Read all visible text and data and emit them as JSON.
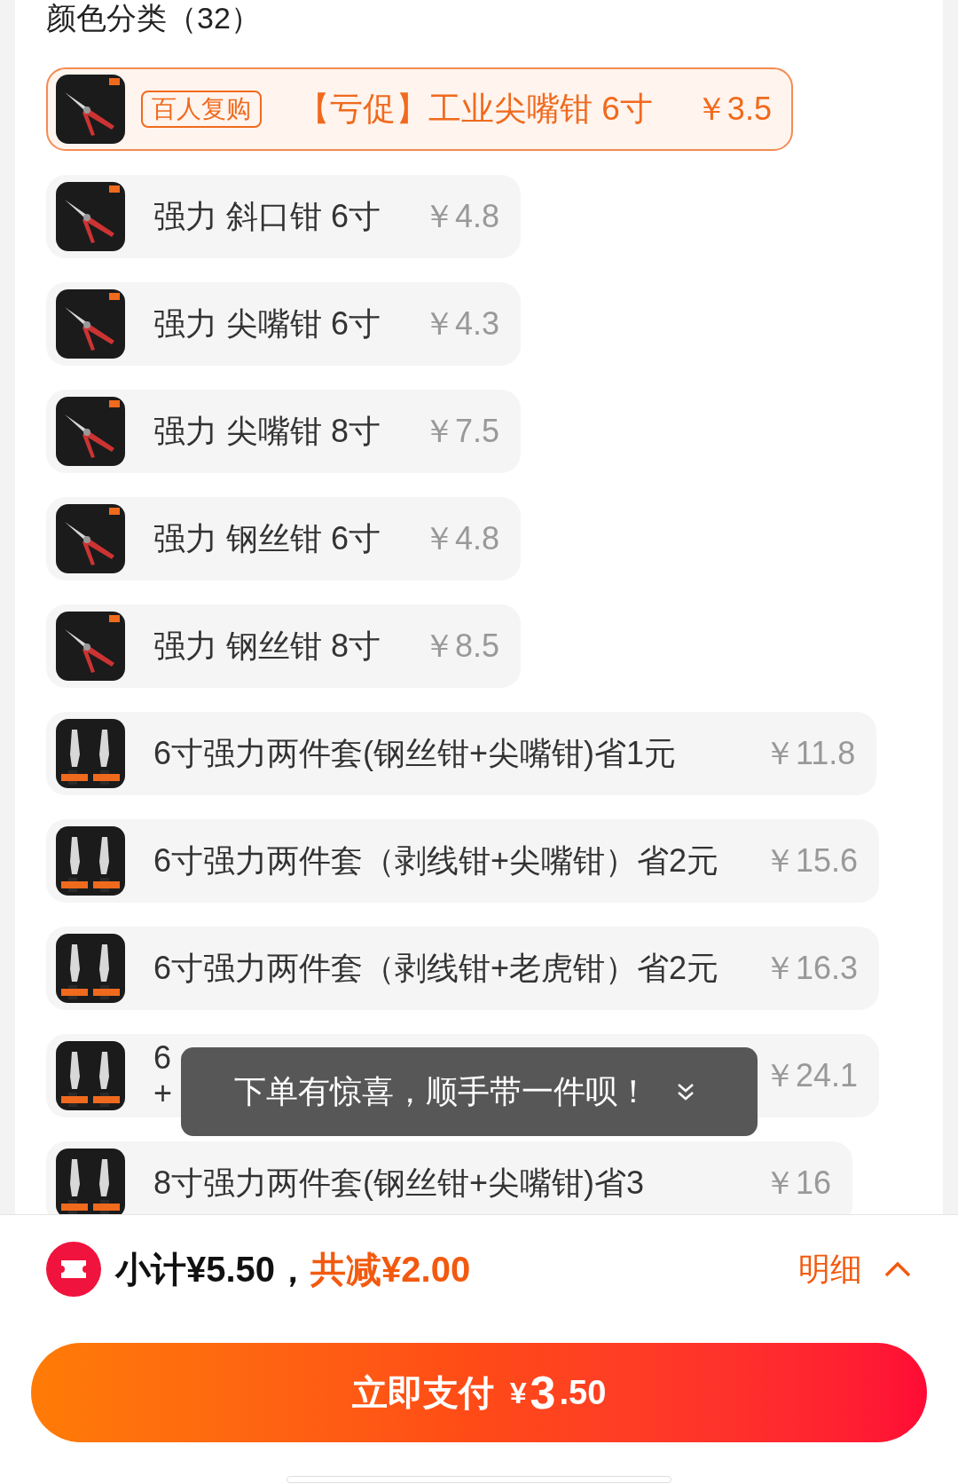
{
  "section_title": "颜色分类（32）",
  "options": [
    {
      "name": "【亏促】工业尖嘴钳 6寸",
      "price": "￥3.5",
      "selected": true,
      "badge": "百人复购",
      "kind": "single"
    },
    {
      "name": "强力 斜口钳 6寸",
      "price": "￥4.8",
      "selected": false,
      "kind": "single"
    },
    {
      "name": "强力 尖嘴钳 6寸",
      "price": "￥4.3",
      "selected": false,
      "kind": "single"
    },
    {
      "name": "强力 尖嘴钳 8寸",
      "price": "￥7.5",
      "selected": false,
      "kind": "single"
    },
    {
      "name": "强力 钢丝钳 6寸",
      "price": "￥4.8",
      "selected": false,
      "kind": "single"
    },
    {
      "name": "强力 钢丝钳 8寸",
      "price": "￥8.5",
      "selected": false,
      "kind": "single"
    },
    {
      "name": "6寸强力两件套(钢丝钳+尖嘴钳)省1元",
      "price": "￥11.8",
      "selected": false,
      "kind": "set"
    },
    {
      "name": "6寸强力两件套（剥线钳+尖嘴钳）省2元",
      "price": "￥15.6",
      "selected": false,
      "kind": "set"
    },
    {
      "name": "6寸强力两件套（剥线钳+老虎钳）省2元",
      "price": "￥16.3",
      "selected": false,
      "kind": "set"
    },
    {
      "name_parts": [
        "6",
        "+"
      ],
      "price": "￥24.1",
      "selected": false,
      "kind": "set"
    },
    {
      "name": "8寸强力两件套(钢丝钳+尖嘴钳)省3",
      "price": "￥16",
      "selected": false,
      "kind": "set"
    }
  ],
  "toast": "下单有惊喜，顺手带一件呗！",
  "summary": {
    "subtotal": "小计¥5.50，",
    "discount": "共减¥2.00",
    "details": "明细"
  },
  "pay_button": {
    "label": "立即支付",
    "symbol": "¥",
    "integer": "3",
    "decimals": ".50"
  }
}
